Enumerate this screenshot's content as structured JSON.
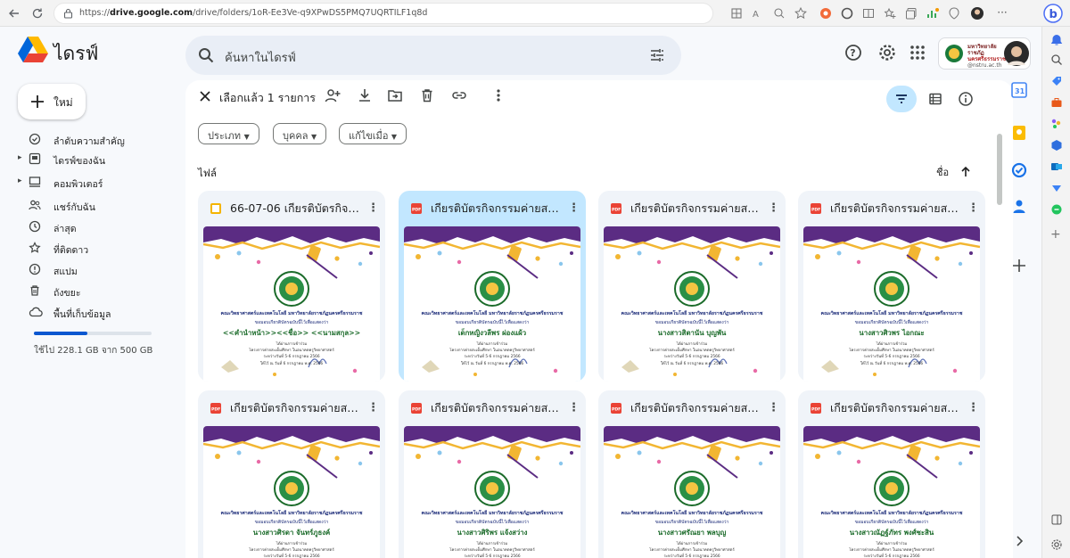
{
  "browser": {
    "url_prefix": "https://",
    "url_host": "drive.google.com",
    "url_path": "/drive/folders/1oR-Ee3Ve-q9XPwDS5PMQ7UQRTILF1q8d"
  },
  "app": {
    "name": "ไดรฟ์"
  },
  "search": {
    "placeholder": "ค้นหาในไดรฟ์"
  },
  "account": {
    "org_line1": "มหาวิทยาลัยราชภัฏ",
    "org_line2": "นครศรีธรรมราช",
    "domain": "@nstru.ac.th"
  },
  "sidebar": {
    "new_label": "ใหม่",
    "items": [
      {
        "label": "ลำดับความสำคัญ",
        "icon": "priority-icon"
      },
      {
        "label": "ไดรฟ์ของฉัน",
        "icon": "my-drive-icon"
      },
      {
        "label": "คอมพิวเตอร์",
        "icon": "computer-icon"
      },
      {
        "label": "แชร์กับฉัน",
        "icon": "shared-icon"
      },
      {
        "label": "ล่าสุด",
        "icon": "clock-icon"
      },
      {
        "label": "ที่ติดดาว",
        "icon": "star-icon"
      },
      {
        "label": "สแปม",
        "icon": "spam-icon"
      },
      {
        "label": "ถังขยะ",
        "icon": "trash-icon"
      },
      {
        "label": "พื้นที่เก็บข้อมูล",
        "icon": "cloud-icon"
      }
    ],
    "storage_text": "ใช้ไป 228.1 GB จาก 500 GB",
    "storage_fraction": 0.456
  },
  "toolbar": {
    "selection_text": "เลือกแล้ว 1 รายการ"
  },
  "filters": [
    "ประเภท",
    "บุคคล",
    "แก้ไขเมื่อ"
  ],
  "section": {
    "files_label": "ไฟล์",
    "sort_label": "ชื่อ"
  },
  "certificate": {
    "org": "คณะวิทยาศาสตร์และเทคโนโลยี มหาวิทยาลัยราชภัฏนครศรีธรรมราช",
    "subtitle": "ขอมอบเกียรติบัตรฉบับนี้ไว้เพื่อแสดงว่า",
    "line1": "ได้ผ่านการเข้าร่วม",
    "line2": "โครงการค่ายสะเต็มศึกษา ในอนาคตครูวิทยาศาสตร์",
    "line3": "ระหว่างวันที่ 5-6 กรกฎาคม 2566",
    "line4": "ให้ไว้ ณ วันที่ 6 กรกฎาคม พ.ศ. 2566"
  },
  "files": [
    {
      "name": "66-07-06 เกียรติบัตรกิจกร...",
      "type": "slides",
      "recipient": "<<คำนำหน้า>><<ชื่อ>> <<นามสกุล>>",
      "selected": false
    },
    {
      "name": "เกียรติบัตรกิจกรรมค่ายสะเต็...",
      "type": "pdf",
      "recipient": "เด็กหญิงวลีพร ผ่องแผ้ว",
      "selected": true
    },
    {
      "name": "เกียรติบัตรกิจกรรมค่ายสะเต็...",
      "type": "pdf",
      "recipient": "นางสาวสิตานัน บุญพัน",
      "selected": false
    },
    {
      "name": "เกียรติบัตรกิจกรรมค่ายสะเต็...",
      "type": "pdf",
      "recipient": "นางสาวศิวพร ไอกณะ",
      "selected": false
    },
    {
      "name": "เกียรติบัตรกิจกรรมค่ายสะเต็...",
      "type": "pdf",
      "recipient": "นางสาวศิรดา จันทร์ภูธงค์",
      "selected": false
    },
    {
      "name": "เกียรติบัตรกิจกรรมค่ายสะเต็...",
      "type": "pdf",
      "recipient": "นางสาวศิริพร แจ้งสว่าง",
      "selected": false
    },
    {
      "name": "เกียรติบัตรกิจกรรมค่ายสะเต็...",
      "type": "pdf",
      "recipient": "นางสาวศรัณยา พลบุญ",
      "selected": false
    },
    {
      "name": "เกียรติบัตรกิจกรรมค่ายสะเต็...",
      "type": "pdf",
      "recipient": "นางสาวณัฏฐ์ภัทร พงศ์ชะสิน",
      "selected": false
    }
  ],
  "colors": {
    "accent": "#0b57d0",
    "selected": "#c2e7ff",
    "pdf": "#ea4335",
    "slides": "#f4b400"
  }
}
